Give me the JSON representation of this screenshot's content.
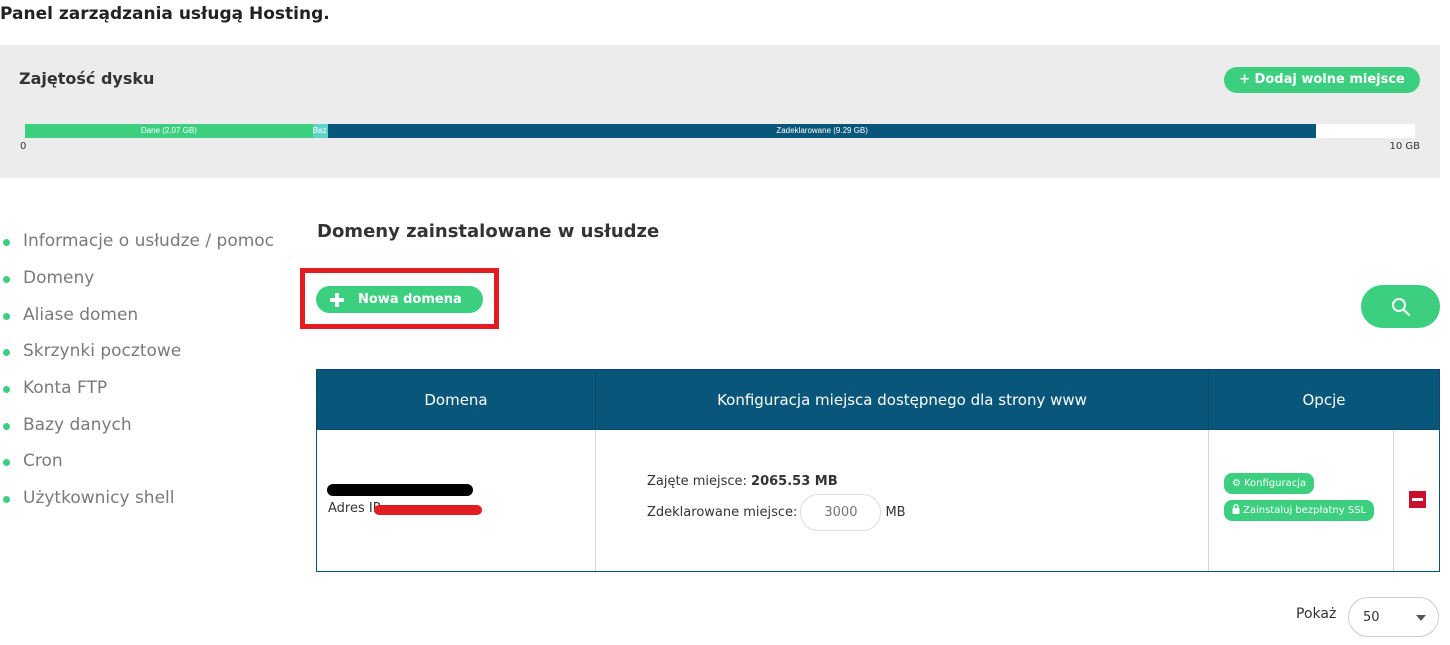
{
  "page_title": "Panel zarządzania usługą Hosting.",
  "disk": {
    "title": "Zajętość dysku",
    "add_space_label": "+ Dodaj wolne miejsce",
    "bar_min": "0",
    "bar_max": "10 GB",
    "total_gb": 10,
    "segments": [
      {
        "label": "Dane (2.07 GB)",
        "value_gb": 2.07,
        "color": "#3ccf7f"
      },
      {
        "label": "Baz",
        "value_gb": 0.11,
        "color": "#5fd3c8"
      },
      {
        "label": "Zadeklarowane (9.29 GB)",
        "value_gb": 7.11,
        "color": "#08577a"
      }
    ]
  },
  "sidebar": {
    "items": [
      {
        "label": "Informacje o usłudze / pomoc"
      },
      {
        "label": "Domeny"
      },
      {
        "label": "Aliase domen"
      },
      {
        "label": "Skrzynki pocztowe"
      },
      {
        "label": "Konta FTP"
      },
      {
        "label": "Bazy danych"
      },
      {
        "label": "Cron"
      },
      {
        "label": "Użytkownicy shell"
      }
    ]
  },
  "main": {
    "section_title": "Domeny zainstalowane w usłudze",
    "new_domain_label": "Nowa domena",
    "search_icon": "search-icon",
    "table": {
      "headers": [
        "Domena",
        "Konfiguracja miejsca dostępnego dla strony www",
        "Opcje"
      ],
      "rows": [
        {
          "ip_label": "Adres IP:",
          "used_label": "Zajęte miejsce:",
          "used_value": "2065.53 MB",
          "declared_label": "Zdeklarowane miejsce:",
          "declared_placeholder": "3000",
          "declared_unit": "MB",
          "config_label": "Konfiguracja",
          "ssl_label": "Zainstaluj bezpłatny SSL"
        }
      ]
    },
    "pagination": {
      "show_label": "Pokaż",
      "page_size": "50"
    }
  },
  "colors": {
    "accent": "#3ccf7f",
    "header": "#08577a",
    "highlight": "#e31b23",
    "danger": "#c8102e"
  }
}
